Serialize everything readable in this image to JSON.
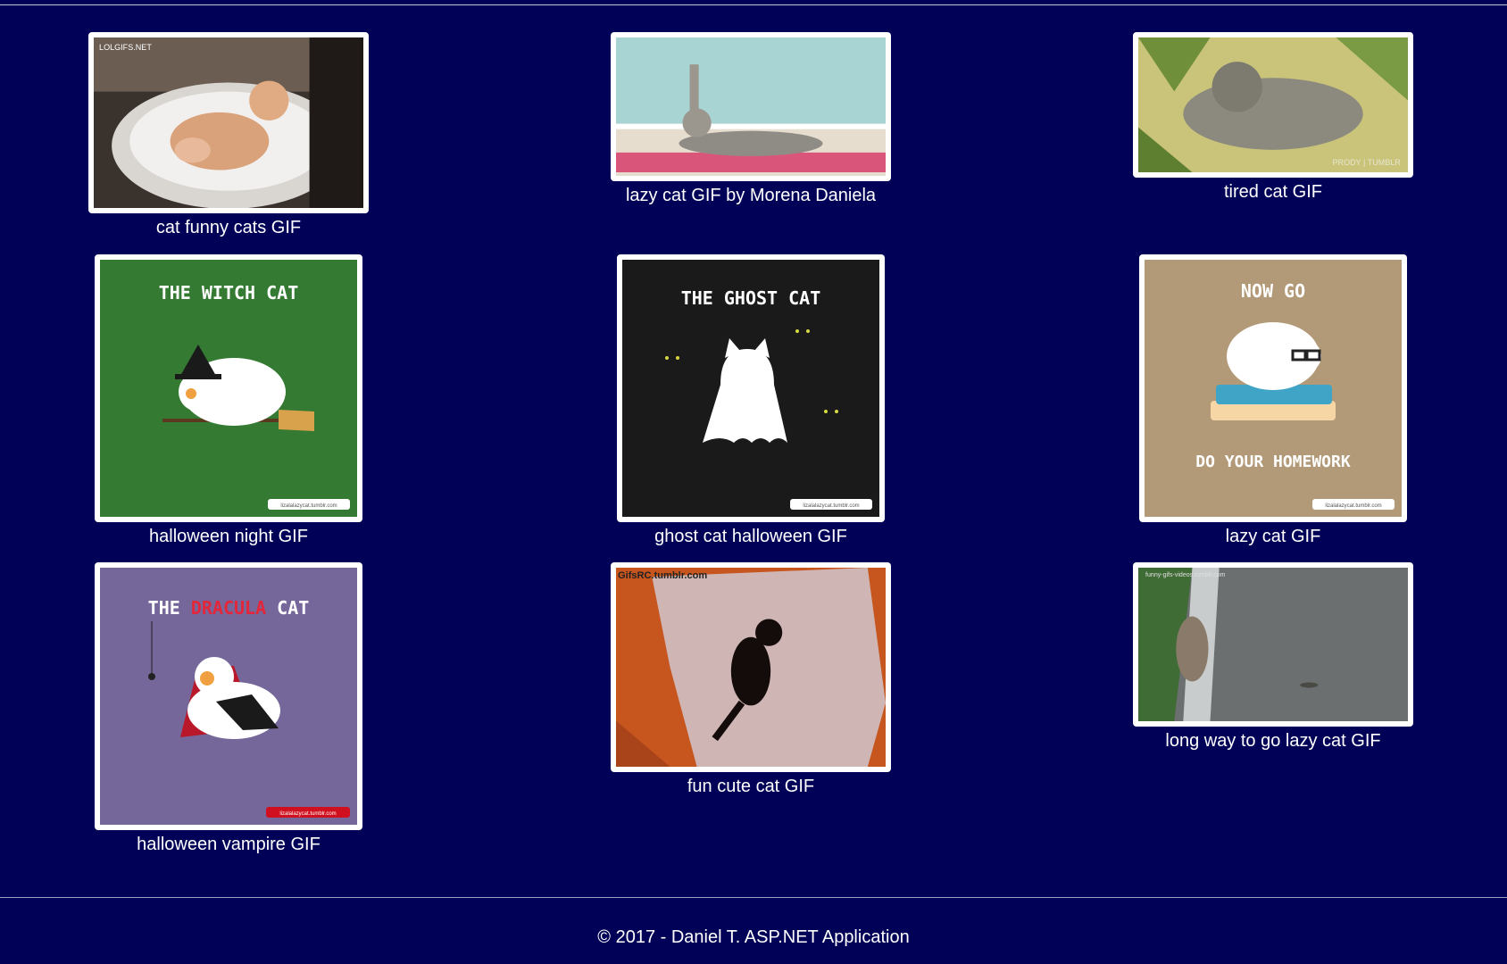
{
  "gallery": {
    "items": [
      {
        "caption": "cat funny cats GIF",
        "watermark": "LOLGIFS.NET",
        "image": "cat-in-sink"
      },
      {
        "caption": "lazy cat GIF by Morena Daniela",
        "image": "cat-on-yoga-mat"
      },
      {
        "caption": "tired cat GIF",
        "watermark": "PRODY | TUMBLR",
        "image": "sleeping-cat"
      },
      {
        "caption": "halloween night GIF",
        "title": "THE WITCH CAT",
        "watermark": "lizalalazycat.tumblr.com",
        "image": "witch-cat-illustration"
      },
      {
        "caption": "ghost cat halloween GIF",
        "title": "THE GHOST CAT",
        "watermark": "lizalalazycat.tumblr.com",
        "image": "ghost-cat-illustration"
      },
      {
        "caption": "lazy cat GIF",
        "title": "NOW GO",
        "subtitle": "DO YOUR HOMEWORK",
        "watermark": "lizalalazycat.tumblr.com",
        "image": "homework-cat-illustration"
      },
      {
        "caption": "halloween vampire GIF",
        "title_a": "THE ",
        "title_b": "DRACULA",
        "title_c": " CAT",
        "watermark": "lizalalazycat.tumblr.com",
        "image": "dracula-cat-illustration"
      },
      {
        "caption": "fun cute cat GIF",
        "watermark": "GifsRC.tumblr.com",
        "image": "black-cat-on-rug"
      },
      {
        "caption": "long way to go lazy cat GIF",
        "watermark": "funny-gifs-videos.tumblr.com",
        "image": "cat-on-rail"
      }
    ]
  },
  "footer": {
    "text": "© 2017 - Daniel T. ASP.NET Application"
  },
  "colors": {
    "background": "#010157",
    "frame": "#ffffff",
    "text": "#ffffff"
  }
}
